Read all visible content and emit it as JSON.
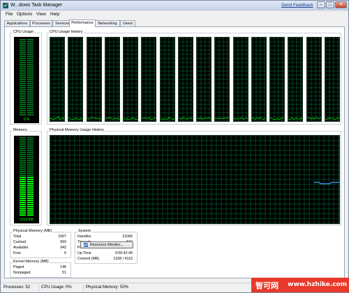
{
  "window": {
    "title": "W...dows Task Manager",
    "send_feedback": "Send Feedback",
    "minimize": "–",
    "maximize": "□",
    "close": "✕"
  },
  "menu": {
    "items": [
      "File",
      "Options",
      "View",
      "Help"
    ]
  },
  "tabs": {
    "items": [
      "Applications",
      "Processes",
      "Services",
      "Performance",
      "Networking",
      "Users"
    ],
    "active": "Performance"
  },
  "cpu": {
    "usage_label": "CPU Usage",
    "usage_value": "0 %",
    "usage_percent": 0,
    "history_label": "CPU Usage History",
    "core_count": 16
  },
  "memory": {
    "label": "Memory",
    "value": "1014 MB",
    "usage_percent": 50,
    "history_label": "Physical Memory Usage History"
  },
  "physical_memory": {
    "title": "Physical Memory (MB)",
    "rows": [
      {
        "label": "Total",
        "value": "1907"
      },
      {
        "label": "Cached",
        "value": "993"
      },
      {
        "label": "Available",
        "value": "942"
      },
      {
        "label": "Free",
        "value": "0"
      }
    ]
  },
  "kernel_memory": {
    "title": "Kernel Memory (MB)",
    "rows": [
      {
        "label": "Paged",
        "value": "146"
      },
      {
        "label": "Nonpaged",
        "value": "51"
      }
    ]
  },
  "system": {
    "title": "System",
    "rows": [
      {
        "label": "Handles",
        "value": "21066"
      },
      {
        "label": "Threads",
        "value": "874"
      },
      {
        "label": "Processes",
        "value": "52"
      },
      {
        "label": "Up Time",
        "value": "0:00:42:49"
      },
      {
        "label": "Commit (MB)",
        "value": "1338 / 4115"
      }
    ]
  },
  "resource_monitor": {
    "label": "Resource Monitor..."
  },
  "status": {
    "processes": "Processes: 52",
    "cpu": "CPU Usage: 0%",
    "memory": "Physical Memory: 50%"
  },
  "watermark": {
    "text_cn": "智可网",
    "url": "www.hzhike.com"
  },
  "colors": {
    "graph_green": "#00ff00",
    "grid_green": "#008040",
    "history_blue": "#3fa0ff",
    "accent": "#e8392b"
  }
}
